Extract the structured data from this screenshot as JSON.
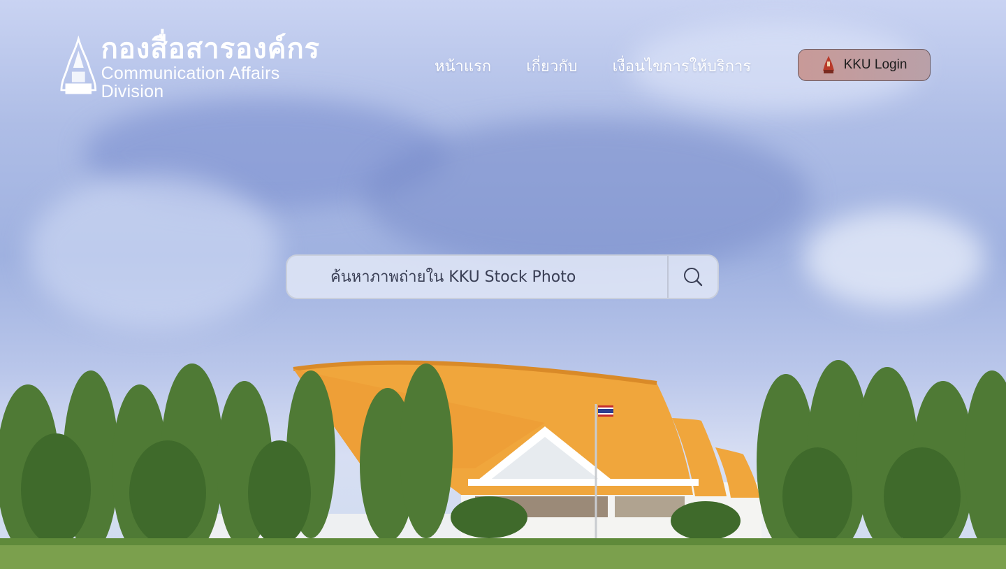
{
  "header": {
    "logo_title_th": "กองสื่อสารองค์กร",
    "logo_subtitle_en": "Communication Affairs Division"
  },
  "nav": {
    "items": [
      {
        "label": "หน้าแรก"
      },
      {
        "label": "เกี่ยวกับ"
      },
      {
        "label": "เงื่อนไขการให้บริการ"
      }
    ]
  },
  "login": {
    "label": "KKU Login"
  },
  "search": {
    "placeholder": "ค้นหาภาพถ่ายใน KKU Stock Photo"
  },
  "icons": {
    "logo": "temple-emblem-icon",
    "login": "kku-emblem-icon",
    "search": "search-icon"
  },
  "colors": {
    "roof": "#f0a63c",
    "trees": "#4f7a35",
    "login_bg": "#c89a98"
  }
}
